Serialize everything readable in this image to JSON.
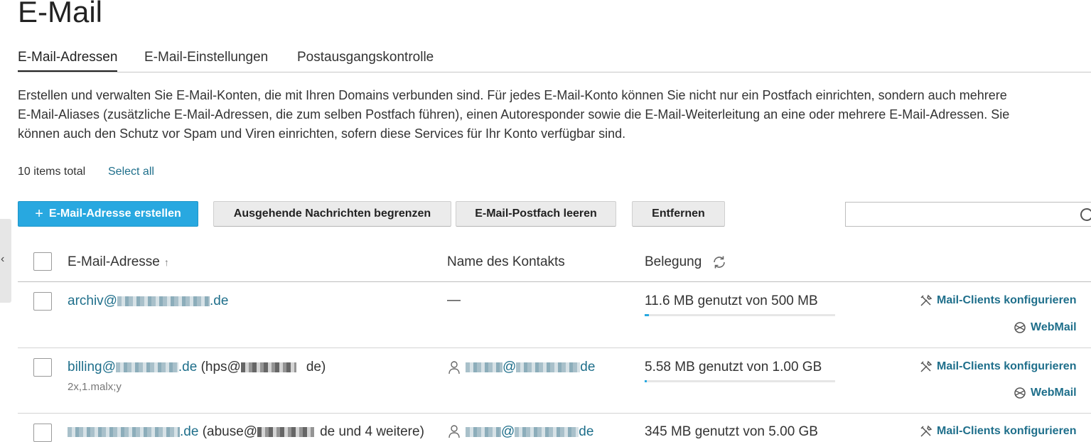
{
  "page": {
    "title": "E-Mail"
  },
  "tabs": [
    {
      "label": "E-Mail-Adressen",
      "active": true
    },
    {
      "label": "E-Mail-Einstellungen",
      "active": false
    },
    {
      "label": "Postausgangskontrolle",
      "active": false
    }
  ],
  "description": [
    "Erstellen und verwalten Sie E-Mail-Konten, die mit Ihren Domains verbunden sind. Für jedes E-Mail-Konto können Sie nicht nur ein Postfach einrichten, sondern auch mehrere",
    "E-Mail-Aliases (zusätzliche E-Mail-Adressen, die zum selben Postfach führen), einen Autoresponder sowie die E-Mail-Weiterleitung an eine oder mehrere E-Mail-Adressen. Sie",
    "können auch den Schutz vor Spam und Viren einrichten, sofern diese Services für Ihr Konto verfügbar sind."
  ],
  "list": {
    "count_label": "10 items total",
    "select_all": "Select all"
  },
  "toolbar": {
    "create": "E-Mail-Adresse erstellen",
    "limit": "Ausgehende Nachrichten begrenzen",
    "empty": "E-Mail-Postfach leeren",
    "remove": "Entfernen",
    "search_value": ""
  },
  "table": {
    "headers": {
      "email": "E-Mail-Adresse",
      "contact": "Name des Kontakts",
      "usage": "Belegung"
    },
    "rows": [
      {
        "email_pre": "archiv@",
        "email_post": ".de",
        "extra": "",
        "sub": "",
        "contact_pre": "",
        "contact_post": "",
        "contact_none": "—",
        "usage": "11.6 MB genutzt von 500 MB",
        "usage_fraction": 0.023,
        "action1": "Mail-Clients konfigurieren",
        "action2": "WebMail"
      },
      {
        "email_pre": "billing@",
        "email_post": ".de",
        "extra_pre": " (hps@",
        "extra_post": "de)",
        "sub": "2x,1.malx;y",
        "contact_pre": "",
        "contact_post": "@",
        "contact_domain": "de",
        "contact_none": "",
        "usage": "5.58 MB genutzt von 1.00 GB",
        "usage_fraction": 0.005,
        "action1": "Mail-Clients konfigurieren",
        "action2": "WebMail"
      },
      {
        "email_pre": "",
        "email_post": ".de",
        "extra_pre": " (abuse@",
        "extra_post": "de und 4 weitere)",
        "sub": "",
        "contact_post": "@",
        "contact_domain": "de",
        "contact_none": "",
        "usage": "345 MB genutzt von 5.00 GB",
        "usage_fraction": 0.067,
        "action1": "Mail-Clients konfigurieren",
        "action2": ""
      }
    ]
  },
  "colors": {
    "accent": "#28a8e0",
    "link": "#1f6f8b"
  }
}
